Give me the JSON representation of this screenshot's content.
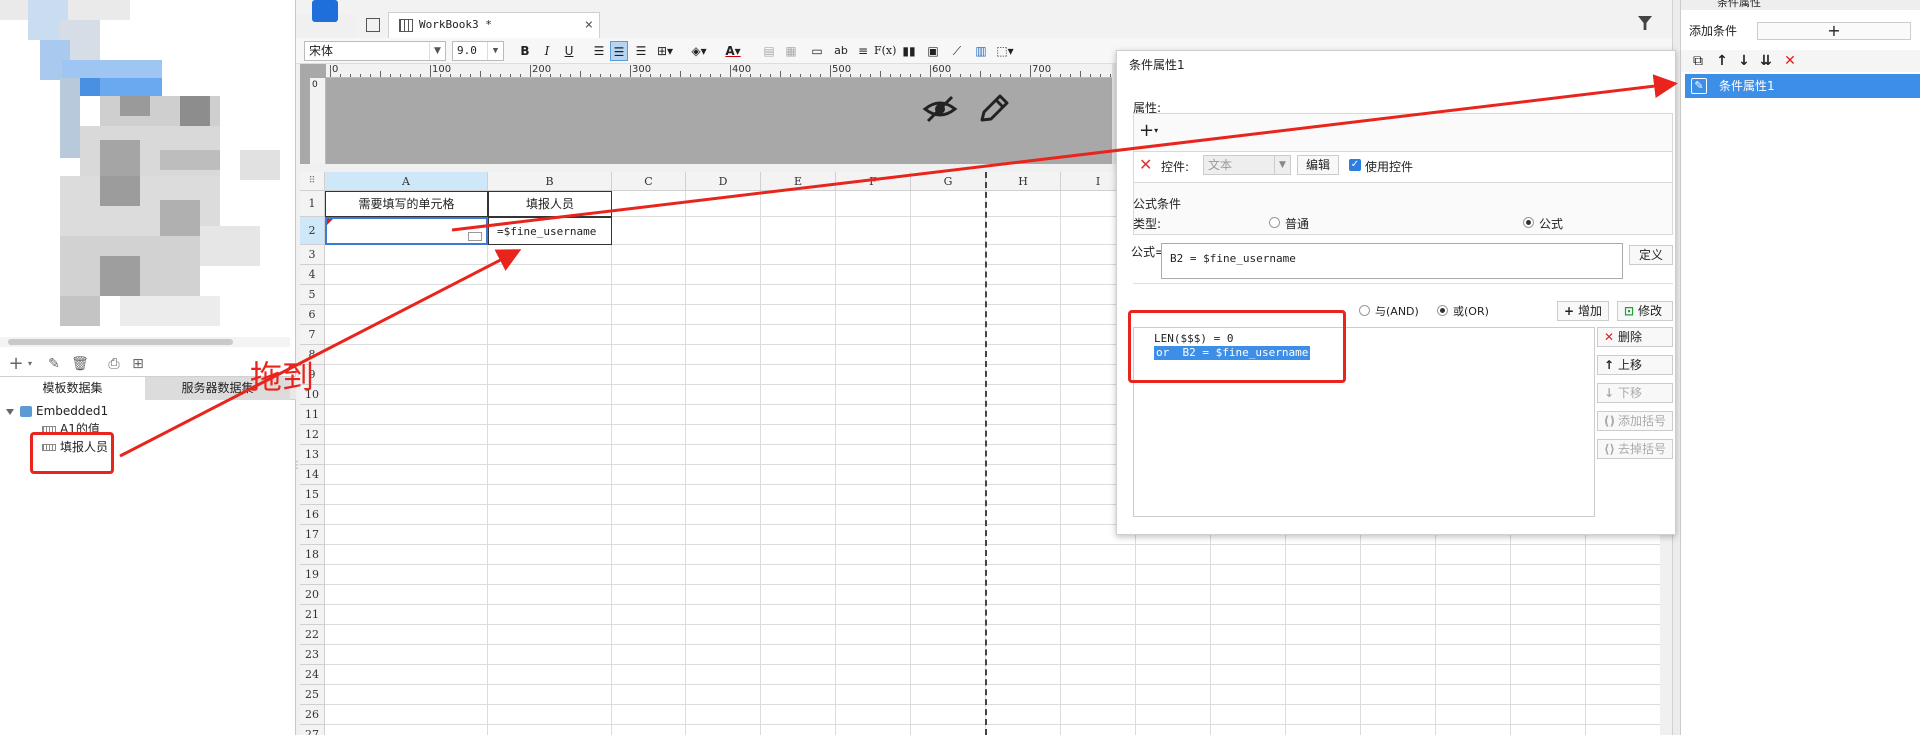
{
  "left_panel": {
    "tabs": {
      "template": "模板数据集",
      "server": "服务器数据集"
    },
    "tree": {
      "root": "Embedded1",
      "fields": [
        "A1的值",
        "填报人员"
      ]
    },
    "toolbar_icons": [
      "plus-icon",
      "chevron-down-icon",
      "pencil-icon",
      "trash-icon",
      "preview-icon",
      "dataset-icon"
    ]
  },
  "annotation": {
    "drag_label": "拖到",
    "color": "#e8241c"
  },
  "tab": {
    "title": "WorkBook3 *",
    "close": "×"
  },
  "toolbar": {
    "font": "宋体",
    "size": "9.0",
    "buttons": [
      "B",
      "I",
      "U",
      "ab",
      "F(x)"
    ]
  },
  "ruler": {
    "ticks": [
      "0",
      "100",
      "200",
      "300",
      "400",
      "500",
      "600",
      "700"
    ]
  },
  "grid": {
    "columns": [
      "A",
      "B",
      "C",
      "D",
      "E",
      "F",
      "G",
      "H",
      "I"
    ],
    "rows": [
      "1",
      "2",
      "3",
      "4",
      "5",
      "6",
      "7",
      "8",
      "9",
      "10",
      "11",
      "12",
      "13",
      "14",
      "15",
      "16",
      "17",
      "18",
      "19",
      "20",
      "21",
      "22",
      "23",
      "24",
      "25",
      "26",
      "27"
    ],
    "cells": {
      "a1": "需要填写的单元格",
      "b1": "填报人员",
      "b2": "=$fine_username"
    }
  },
  "dialog": {
    "title": "条件属性1",
    "property_label": "属性:",
    "control_label": "控件:",
    "control_value": "文本",
    "edit_button": "编辑",
    "use_control_label": "使用控件",
    "formula_section": "公式条件",
    "type_label": "类型:",
    "type_normal": "普通",
    "type_formula": "公式",
    "formula_label": "公式=",
    "formula_value": "B2 = $fine_username",
    "define_button": "定义",
    "and_label": "与(AND)",
    "or_label": "或(OR)",
    "add_button": "增加",
    "modify_button": "修改",
    "conditions": [
      "LEN($$$) = 0",
      "or  B2 = $fine_username"
    ],
    "delete_button": "删除",
    "up_button": "上移",
    "down_button": "下移",
    "add_bracket_button": "添加括号",
    "remove_bracket_button": "去掉括号"
  },
  "right_panel": {
    "title": "条件属性",
    "add_condition_label": "添加条件",
    "add_symbol": "+",
    "item": "条件属性1",
    "accent": "#3d8ee6"
  }
}
